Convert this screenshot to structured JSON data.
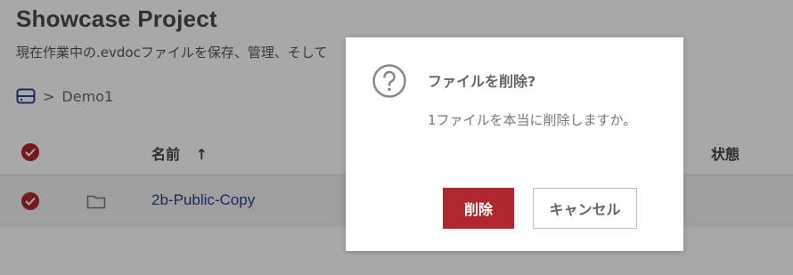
{
  "page": {
    "title": "Showcase Project",
    "subtitle": "現在作業中の.evdocファイルを保存、管理、そして"
  },
  "breadcrumb": {
    "separator": ">",
    "current": "Demo1"
  },
  "table": {
    "headers": {
      "name": "名前",
      "sort_arrow": "↑",
      "status": "状態"
    },
    "rows": [
      {
        "name": "2b-Public-Copy",
        "status": ""
      }
    ]
  },
  "dialog": {
    "icon": "question-circle-icon",
    "title": "ファイルを削除?",
    "message": "1ファイルを本当に削除しますか。",
    "delete_label": "削除",
    "cancel_label": "キャンセル"
  },
  "colors": {
    "accent": "#b0282f",
    "link": "#2b3f8f",
    "overlay": "rgba(0,0,0,0.34)"
  }
}
